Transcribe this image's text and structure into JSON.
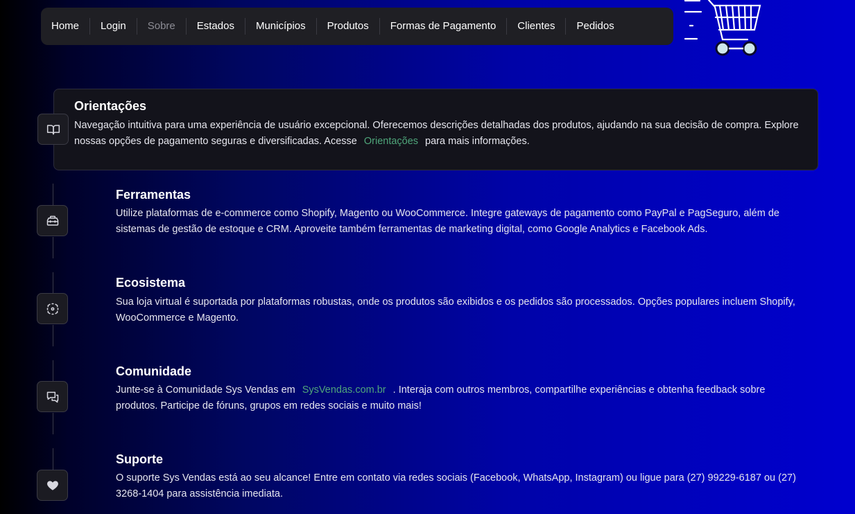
{
  "nav": {
    "items": [
      {
        "label": "Home",
        "active": false
      },
      {
        "label": "Login",
        "active": false
      },
      {
        "label": "Sobre",
        "active": true
      },
      {
        "label": "Estados",
        "active": false
      },
      {
        "label": "Municípios",
        "active": false
      },
      {
        "label": "Produtos",
        "active": false
      },
      {
        "label": "Formas de Pagamento",
        "active": false
      },
      {
        "label": "Clientes",
        "active": false
      },
      {
        "label": "Pedidos",
        "active": false
      }
    ]
  },
  "logo": {
    "icon": "shopping-cart-icon"
  },
  "sections": [
    {
      "icon": "book-icon",
      "title": "Orientações",
      "text_before": "Navegação intuitiva para uma experiência de usuário excepcional. Oferecemos descrições detalhadas dos produtos, ajudando na sua decisão de compra. Explore nossas opções de pagamento seguras e diversificadas. Acesse",
      "link": "Orientações",
      "text_after": "para mais informações."
    },
    {
      "icon": "toolbox-icon",
      "title": "Ferramentas",
      "text": "Utilize plataformas de e-commerce como Shopify, Magento ou WooCommerce. Integre gateways de pagamento como PayPal e PagSeguro, além de sistemas de gestão de estoque e CRM. Aproveite também ferramentas de marketing digital, como Google Analytics e Facebook Ads."
    },
    {
      "icon": "ecosystem-icon",
      "title": "Ecosistema",
      "text": "Sua loja virtual é suportada por plataformas robustas, onde os produtos são exibidos e os pedidos são processados. Opções populares incluem Shopify, WooCommerce e Magento."
    },
    {
      "icon": "chat-icon",
      "title": "Comunidade",
      "text_before": "Junte-se à Comunidade Sys Vendas em",
      "link": "SysVendas.com.br",
      "text_after": ". Interaja com outros membros, compartilhe experiências e obtenha feedback sobre produtos. Participe de fóruns, grupos em redes sociais e muito mais!"
    },
    {
      "icon": "heart-icon",
      "title": "Suporte",
      "text": "O suporte Sys Vendas está ao seu alcance! Entre em contato via redes sociais (Facebook, WhatsApp, Instagram) ou ligue para (27) 99229-6187 ou (27) 3268-1404 para assistência imediata."
    }
  ],
  "colors": {
    "link": "#4fa57a",
    "card_bg": "#13131b",
    "nav_bg": "#1f1f24",
    "bg_start": "#000000",
    "bg_end": "#0000cf"
  }
}
